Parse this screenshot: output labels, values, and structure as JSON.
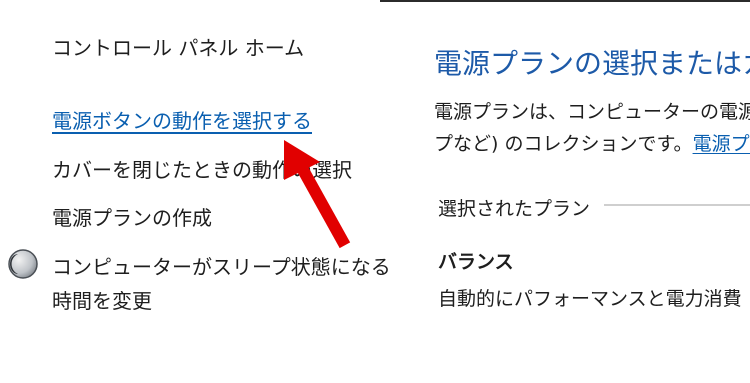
{
  "sidebar": {
    "home_label": "コントロール パネル ホーム",
    "links": [
      {
        "label": "電源ボタンの動作を選択する",
        "is_link": true
      },
      {
        "label": "カバーを閉じたときの動作の選択",
        "is_link": false
      },
      {
        "label": "電源プランの作成",
        "is_link": false
      }
    ],
    "sleep_line1": "コンピューターがスリープ状態になる",
    "sleep_line2": "時間を変更",
    "sleep_icon": "moon-icon"
  },
  "main": {
    "title": "電源プランの選択またはカ",
    "desc_line1": "電源プランは、コンピューターの電源",
    "desc_line2_text": "プなど) のコレクションです。",
    "desc_line2_link": "電源プラ",
    "section_label": "選択されたプラン",
    "plan_name": "バランス",
    "plan_desc": "自動的にパフォーマンスと電力消費"
  },
  "annotation": {
    "arrow_color": "#e10000",
    "icon": "red-arrow-annotation"
  },
  "colors": {
    "link": "#0a5fb0",
    "title": "#1d5aa8",
    "text": "#1e1e1e"
  }
}
